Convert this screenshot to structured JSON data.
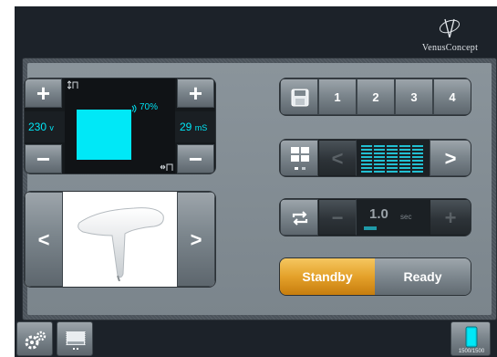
{
  "brand": {
    "name": "VenusConcept"
  },
  "pulse": {
    "voltage_value": "230",
    "voltage_unit": "v",
    "duration_value": "29",
    "duration_unit": "mS",
    "energy_percent": "70%",
    "increase_label": "+",
    "decrease_label": "−"
  },
  "handpiece": {
    "prev_label": "<",
    "next_label": ">"
  },
  "program": {
    "slots": [
      "1",
      "2",
      "3",
      "4"
    ]
  },
  "pattern": {
    "prev_label": "<",
    "next_label": ">"
  },
  "repeat": {
    "value": "1.0",
    "unit": "sec",
    "decrease_label": "−",
    "increase_label": "+"
  },
  "mode": {
    "standby_label": "Standby",
    "ready_label": "Ready",
    "active": "Standby"
  },
  "counter": {
    "text": "1500/1500"
  },
  "colors": {
    "accent": "#00e8f7",
    "standby": "#e4a12a",
    "panel": "#7b858c"
  },
  "icons": [
    "logo-icon",
    "save-icon",
    "layout-icon",
    "repeat-icon",
    "settings-icon",
    "display-icon",
    "battery-icon"
  ]
}
